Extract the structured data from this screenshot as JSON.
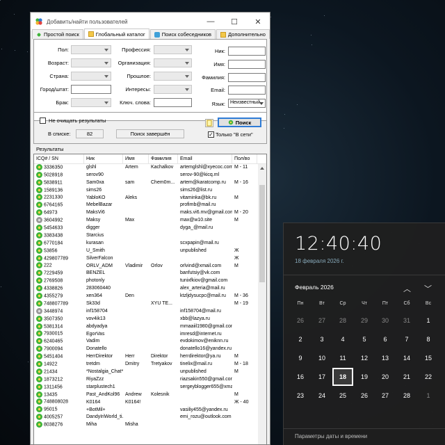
{
  "window": {
    "title": "Добавить/найти пользователей"
  },
  "tabs": [
    {
      "label": "Простой поиск",
      "icon": "search-person-icon"
    },
    {
      "label": "Глобальный каталог",
      "icon": "folder-icon"
    },
    {
      "label": "Поиск собеседников",
      "icon": "chat-search-icon"
    },
    {
      "label": "Дополнительно",
      "icon": "folder-icon"
    }
  ],
  "form": {
    "gender": "Пол:",
    "age": "Возраст:",
    "country": "Страна:",
    "city": "Город/штат:",
    "marital": "Брак:",
    "profession": "Профессия:",
    "organization": "Организация:",
    "past": "Прошлое:",
    "interests": "Интересы:",
    "keywords": "Ключ. слова:",
    "nick": "Ник:",
    "name": "Имя:",
    "surname": "Фамилия:",
    "email": "Email:",
    "language": "Язык:",
    "language_value": "Неизвестный"
  },
  "options": {
    "keep_results": "Не очищать результаты",
    "in_list_label": "В списке:",
    "in_list_value": "82",
    "status": "Поиск завершён",
    "search_button": "Поиск",
    "online_only": "Только \"В сети\""
  },
  "results": {
    "label": "Результаты",
    "columns": [
      "ICQ# / SN",
      "Ник",
      "Имя",
      "Фамилия",
      "Email",
      "Пол/во"
    ],
    "rows": [
      [
        "3336350",
        "glshl",
        "Artem",
        "Kachalkov",
        "artemglshl@xyecoc.com",
        "М - 11"
      ],
      [
        "5028918",
        "serov90",
        "",
        "",
        "serov-90@kicq.ml",
        ""
      ],
      [
        "5838911",
        "Sam0xa",
        "sam",
        "Chem0m...",
        "artem@karatcomp.ru",
        "М - 16"
      ],
      [
        "1589136",
        "sims26",
        "",
        "",
        "sims26@list.ru",
        ""
      ],
      [
        "2231330",
        "YabloKO",
        "Aleks",
        "",
        "vitaminka@bk.ru",
        "М"
      ],
      [
        "6764165",
        "MebelBazar",
        "",
        "",
        "profimb@mail.ru",
        ""
      ],
      [
        "64973",
        "MaksVi6",
        "",
        "",
        "maks.vi6.mv@gmail.com",
        "М - 20"
      ],
      [
        "3604992",
        "Maksy",
        "Max",
        "",
        "max@w10.site",
        "М"
      ],
      [
        "5454633",
        "digger",
        "",
        "",
        "dyga_@mail.ru",
        ""
      ],
      [
        "3383438",
        "Starcius",
        "",
        "",
        "",
        ""
      ],
      [
        "6770184",
        "kurasan",
        "",
        "",
        "scxpapin@mail.ru",
        ""
      ],
      [
        "53856",
        "U_Smith",
        "",
        "",
        "unpublished",
        "Ж"
      ],
      [
        "429807789",
        "SilverFalcon",
        "",
        "",
        "",
        "Ж"
      ],
      [
        "222",
        "ORLV_ADM",
        "Vladimir",
        "Orlov",
        "orlvind@xmail.com",
        "М"
      ],
      [
        "7229459",
        "BENZEL",
        "",
        "",
        "banfutsiy@vk.com",
        ""
      ],
      [
        "2769508",
        "photonly",
        "",
        "",
        "tunixfkiov@gmail.com",
        ""
      ],
      [
        "4338826",
        "283060440",
        "",
        "",
        "alex_arteria@mail.ru",
        ""
      ],
      [
        "4355279",
        "xen364",
        "Den",
        "",
        "ktzljdysucpc@mail.ru",
        "М - 36"
      ],
      [
        "748807789",
        "Sk33d",
        "",
        "XYU TE...",
        "",
        "М - 19"
      ],
      [
        "3448974",
        "inf158704",
        "",
        "",
        "inf158704@mail.ru",
        ""
      ],
      [
        "3507350",
        "vov4ik13",
        "",
        "",
        "xbb@lazya.ru",
        ""
      ],
      [
        "5381314",
        "abdyadya",
        "",
        "",
        "mmaaiil1980@gmail.com",
        ""
      ],
      [
        "7930015",
        "EgorVas",
        "",
        "",
        "imresd@internet.ru",
        ""
      ],
      [
        "6240465",
        "Vadim",
        "",
        "",
        "evdokimov@eniknn.ru",
        ""
      ],
      [
        "7900094",
        "Donatello",
        "",
        "",
        "donatello16@yandex.ru",
        ""
      ],
      [
        "5451404",
        "HerrDirektor",
        "Herr",
        "Direktor",
        "herrdirektor@ya.ru",
        "М"
      ],
      [
        "14922",
        "tretdm",
        "Dmitry",
        "Tretyakov",
        "tinelix@mail.ru",
        "М - 18"
      ],
      [
        "21434",
        "*Nostalgia_Chat*",
        "",
        "",
        "unpublished",
        "М"
      ],
      [
        "1873212",
        "RiyaZzz",
        "",
        "",
        "riazsakin550@gmail.com",
        ""
      ],
      [
        "1311456",
        "starplustech1",
        "",
        "",
        "sergeyblogger655@xmail.ru",
        ""
      ],
      [
        "13435",
        "Past_AndKol96",
        "Andrew",
        "Kolesnik",
        "",
        "М"
      ],
      [
        "748808028",
        "K0164",
        "K0164!",
        "",
        "",
        "Ж - 40"
      ],
      [
        "95015",
        "+BotMil+",
        "",
        "",
        "vasiliy455@yandex.ru",
        ""
      ],
      [
        "4005257",
        "DandyIriWorld_ti...",
        "",
        "",
        "emi_rozu@outlook.com",
        ""
      ],
      [
        "8038276",
        "Miha",
        "Misha",
        "",
        "",
        ""
      ]
    ]
  },
  "calendar": {
    "time": "12:40:40",
    "date": "18 февраля 2026 г.",
    "month": "Февраль 2026",
    "weekdays": [
      "Пн",
      "Вт",
      "Ср",
      "Чт",
      "Пт",
      "Сб",
      "Вс"
    ],
    "days": [
      "26",
      "27",
      "28",
      "29",
      "30",
      "31",
      "1",
      "2",
      "3",
      "4",
      "5",
      "6",
      "7",
      "8",
      "9",
      "10",
      "11",
      "12",
      "13",
      "14",
      "15",
      "16",
      "17",
      "18",
      "19",
      "20",
      "21",
      "22",
      "23",
      "24",
      "25",
      "26",
      "27",
      "28",
      "1"
    ],
    "dim": [
      0,
      1,
      2,
      3,
      4,
      5,
      34
    ],
    "today_index": 23,
    "settings": "Параметры даты и времени"
  }
}
